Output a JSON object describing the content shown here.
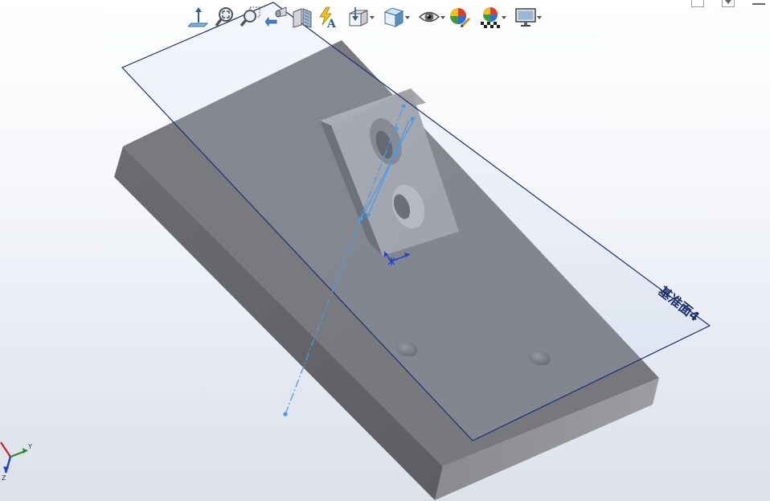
{
  "viewport": {
    "plane_label": "基准面4"
  },
  "toolbar": {
    "items": [
      {
        "name": "normal-to",
        "icon": "normal-to-icon",
        "menu": false
      },
      {
        "name": "zoom-to-fit",
        "icon": "zoom-to-fit-icon",
        "menu": false
      },
      {
        "name": "zoom-to-area",
        "icon": "zoom-to-area-icon",
        "menu": false
      },
      {
        "name": "previous-view",
        "icon": "previous-view-icon",
        "menu": false
      },
      {
        "name": "section-view",
        "icon": "section-view-icon",
        "menu": false
      },
      {
        "name": "dynamic-annotation-views",
        "icon": "dynamic-annotation-icon",
        "menu": false
      },
      {
        "name": "view-orientation",
        "icon": "view-orientation-icon",
        "menu": true
      },
      {
        "name": "display-style",
        "icon": "display-style-icon",
        "menu": true
      },
      {
        "name": "hide-show-items",
        "icon": "hide-show-eye-icon",
        "menu": true
      },
      {
        "name": "edit-appearance",
        "icon": "edit-appearance-icon",
        "menu": false
      },
      {
        "name": "apply-scene",
        "icon": "apply-scene-icon",
        "menu": true
      },
      {
        "name": "view-settings",
        "icon": "view-settings-monitor-icon",
        "menu": true
      }
    ]
  },
  "triad": {
    "y_label": "Y",
    "z_label": "Z"
  },
  "colors": {
    "plane_edge": "#1c2f6e",
    "axis_line": "#4a9be8",
    "axis_y": "#2c8a2c",
    "axis_x": "#d02020",
    "axis_z": "#2040c8"
  }
}
